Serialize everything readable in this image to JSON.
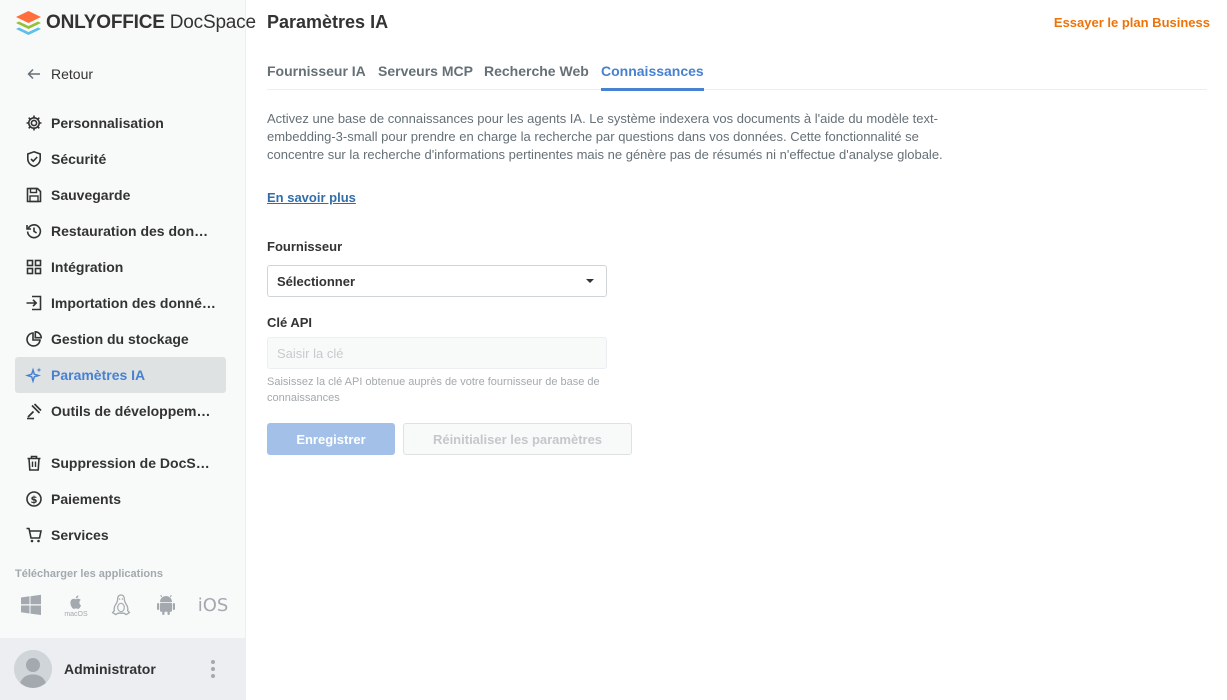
{
  "brand": {
    "name_bold": "ONLYOFFICE",
    "name_rest": " DocSpace"
  },
  "sidebar": {
    "back_label": "Retour",
    "items": [
      {
        "label": "Personnalisation",
        "icon": "gear-icon"
      },
      {
        "label": "Sécurité",
        "icon": "shield-icon"
      },
      {
        "label": "Sauvegarde",
        "icon": "floppy-icon"
      },
      {
        "label": "Restauration des donné…",
        "icon": "history-icon"
      },
      {
        "label": "Intégration",
        "icon": "grid-icon"
      },
      {
        "label": "Importation des données",
        "icon": "import-icon"
      },
      {
        "label": "Gestion du stockage",
        "icon": "pie-icon"
      },
      {
        "label": "Paramètres IA",
        "icon": "ai-sparkle-icon",
        "active": true
      },
      {
        "label": "Outils de développement",
        "icon": "dev-tools-icon"
      },
      {
        "label": "Suppression de DocSpace",
        "icon": "trash-icon"
      },
      {
        "label": "Paiements",
        "icon": "coin-icon"
      },
      {
        "label": "Services",
        "icon": "cart-icon"
      }
    ],
    "download_title": "Télécharger les applications",
    "apps": {
      "macos_sub": "macOS",
      "ios": "iOS"
    }
  },
  "profile": {
    "name": "Administrator"
  },
  "header": {
    "title": "Paramètres IA",
    "business_link": "Essayer le plan Business"
  },
  "tabs": [
    {
      "label": "Fournisseur IA"
    },
    {
      "label": "Serveurs MCP"
    },
    {
      "label": "Recherche Web"
    },
    {
      "label": "Connaissances",
      "active": true
    }
  ],
  "content": {
    "description": "Activez une base de connaissances pour les agents IA. Le système indexera vos documents à l'aide du modèle text-embedding-3-small pour prendre en charge la recherche par questions dans vos données. Cette fonctionnalité se concentre sur la recherche d'informations pertinentes mais ne génère pas de résumés ni n'effectue d'analyse globale.",
    "learn_more": "En savoir plus",
    "provider_label": "Fournisseur",
    "provider_value": "Sélectionner",
    "api_key_label": "Clé API",
    "api_key_placeholder": "Saisir la clé",
    "api_key_value": "",
    "api_key_hint": "Saisissez la clé API obtenue auprès de votre fournisseur de base de connaissances",
    "save_label": "Enregistrer",
    "reset_label": "Réinitialiser les paramètres"
  },
  "colors": {
    "accent": "#4781d1",
    "business": "#ed7309",
    "link": "#316daa"
  }
}
